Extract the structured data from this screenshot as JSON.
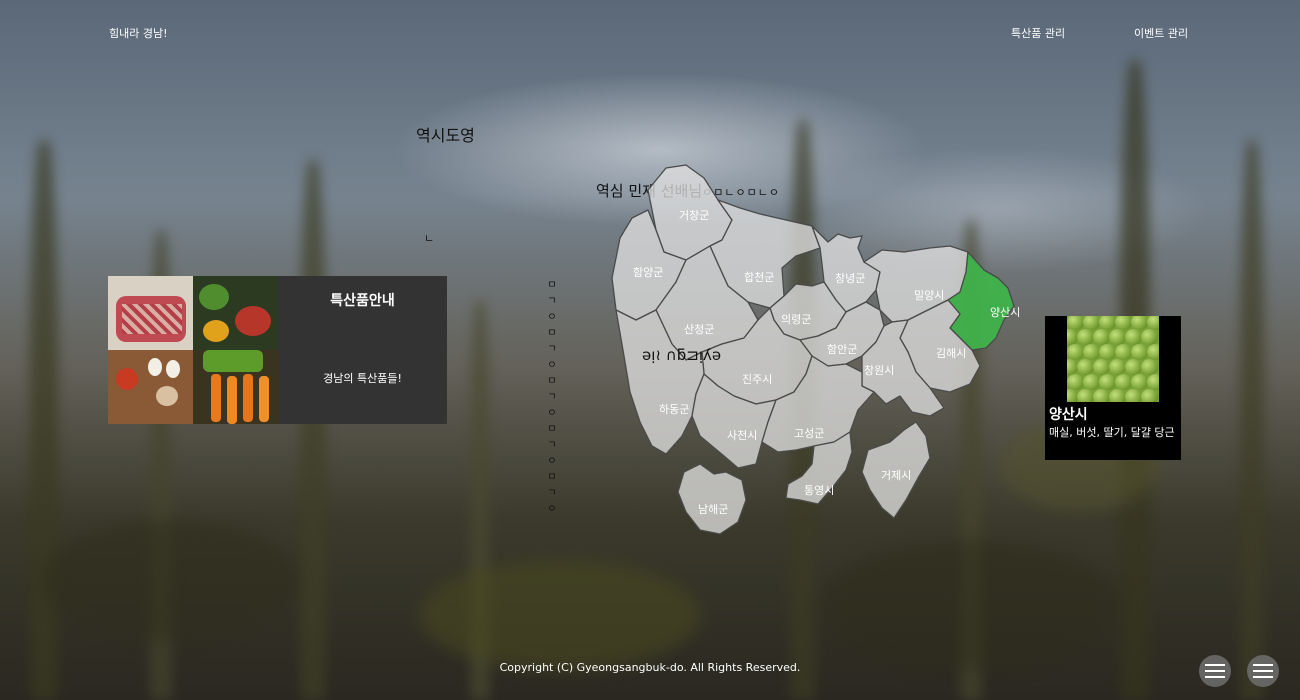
{
  "header": {
    "brand": "힘내라 경남!",
    "nav": [
      "특산품 관리",
      "이벤트 관리"
    ]
  },
  "overlay": {
    "title_mirrored": "역시도영",
    "caption_mirrored": "역심 민재 선배님",
    "caption_trailing": "ㅇㅁㄴㅇㅁㄴㅇ",
    "small_glyph": "ㄴ",
    "vertical_marks": [
      "ㅁ",
      "ㄱ",
      "ㅇ",
      "ㅁ",
      "ㄱ",
      "ㅇ",
      "ㅁ",
      "ㄱ",
      "ㅇ",
      "ㅁ",
      "ㄱ",
      "ㅇ",
      "ㅁ",
      "ㄱ",
      "ㅇ"
    ],
    "flipped_text": "ǝᴉ≀ ∩ƃ⊐ᴉʎǝ"
  },
  "info_card": {
    "title": "특산품안내",
    "subtitle": "경남의 특산품들!"
  },
  "map": {
    "highlight_color": "#3fb24a",
    "region_fill": "#dedede",
    "regions": [
      "거창군",
      "함양군",
      "합천군",
      "창녕군",
      "밀양시",
      "양산시",
      "의령군",
      "산청군",
      "함안군",
      "김해시",
      "창원시",
      "진주시",
      "하동군",
      "사천시",
      "고성군",
      "거제시",
      "통영시",
      "남해군"
    ],
    "selected": "양산시"
  },
  "popup": {
    "name": "양산시",
    "products": "매실, 버섯, 딸기, 달걀 당근"
  },
  "footer": {
    "copyright": "Copyright (C) Gyeongsangbuk-do. All Rights Reserved."
  },
  "icons": [
    "menu-icon",
    "menu-icon"
  ]
}
